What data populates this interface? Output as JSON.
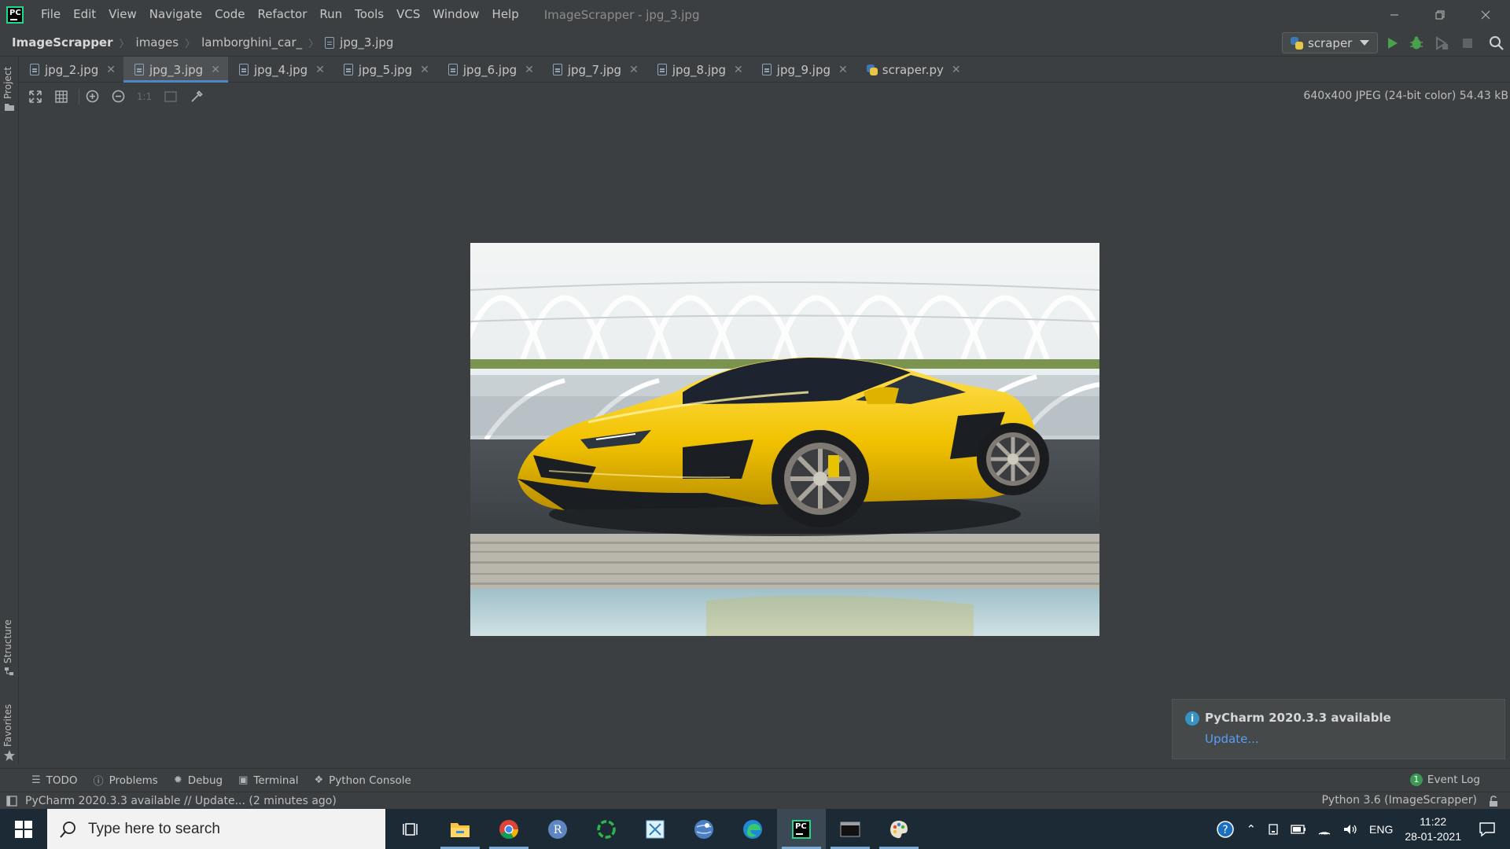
{
  "menu": [
    "File",
    "Edit",
    "View",
    "Navigate",
    "Code",
    "Refactor",
    "Run",
    "Tools",
    "VCS",
    "Window",
    "Help"
  ],
  "window_title": "ImageScrapper - jpg_3.jpg",
  "breadcrumbs": [
    "ImageScrapper",
    "images",
    "lamborghini_car_",
    "jpg_3.jpg"
  ],
  "run_config": "scraper",
  "side_panels": {
    "project": "Project",
    "structure": "Structure",
    "favorites": "Favorites"
  },
  "tabs": [
    {
      "label": "jpg_2.jpg"
    },
    {
      "label": "jpg_3.jpg",
      "active": true
    },
    {
      "label": "jpg_4.jpg"
    },
    {
      "label": "jpg_5.jpg"
    },
    {
      "label": "jpg_6.jpg"
    },
    {
      "label": "jpg_7.jpg"
    },
    {
      "label": "jpg_8.jpg"
    },
    {
      "label": "jpg_9.jpg"
    },
    {
      "label": "scraper.py"
    }
  ],
  "image_toolbar": {
    "actual_size_label": "1:1"
  },
  "image_info": "640x400 JPEG (24-bit color) 54.43 kB",
  "notification": {
    "title": "PyCharm 2020.3.3 available",
    "link": "Update..."
  },
  "tool_windows": [
    "TODO",
    "Problems",
    "Debug",
    "Terminal",
    "Python Console"
  ],
  "event_log": {
    "label": "Event Log",
    "count": "1"
  },
  "status": {
    "message": "PyCharm 2020.3.3 available // Update... (2 minutes ago)",
    "interpreter": "Python 3.6 (ImageScrapper)"
  },
  "taskbar": {
    "search_placeholder": "Type here to search",
    "language": "ENG",
    "time": "11:22",
    "date": "28-01-2021"
  },
  "colors": {
    "ide_bg": "#3c3f41",
    "tab_active_underline": "#4a88c7",
    "link": "#589df6",
    "taskbar": "#1c2a35",
    "car_yellow": "#f2c200"
  }
}
